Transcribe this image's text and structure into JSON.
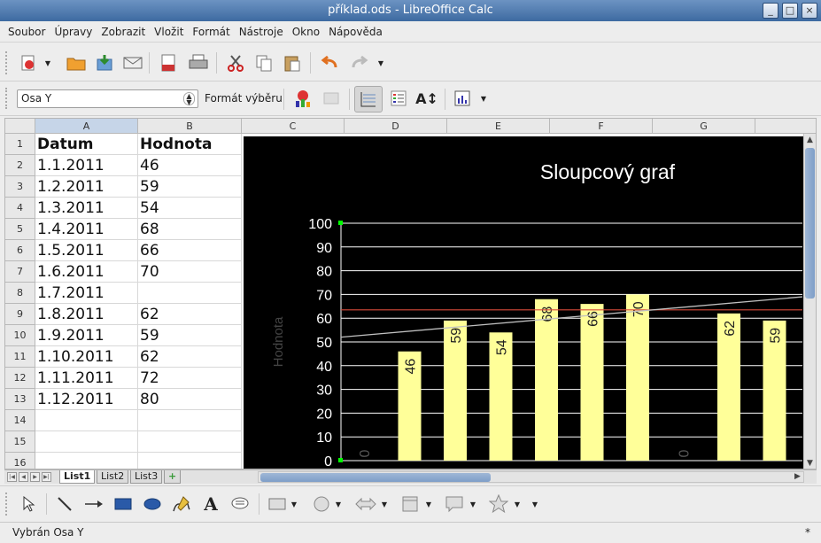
{
  "window": {
    "title": "příklad.ods - LibreOffice Calc"
  },
  "menu": [
    "Soubor",
    "Úpravy",
    "Zobrazit",
    "Vložit",
    "Formát",
    "Nástroje",
    "Okno",
    "Nápověda"
  ],
  "chart_toolbar": {
    "selected_element": "Osa Y",
    "format_selection_label": "Formát výběru"
  },
  "columns": [
    "A",
    "B",
    "C",
    "D",
    "E",
    "F",
    "G"
  ],
  "rows": [
    "1",
    "2",
    "3",
    "4",
    "5",
    "6",
    "7",
    "8",
    "9",
    "10",
    "11",
    "12",
    "13",
    "14",
    "15",
    "16"
  ],
  "cells": [
    [
      "Datum",
      "Hodnota"
    ],
    [
      "1.1.2011",
      "46"
    ],
    [
      "1.2.2011",
      "59"
    ],
    [
      "1.3.2011",
      "54"
    ],
    [
      "1.4.2011",
      "68"
    ],
    [
      "1.5.2011",
      "66"
    ],
    [
      "1.6.2011",
      "70"
    ],
    [
      "1.7.2011",
      ""
    ],
    [
      "1.8.2011",
      "62"
    ],
    [
      "1.9.2011",
      "59"
    ],
    [
      "1.10.2011",
      "62"
    ],
    [
      "1.11.2011",
      "72"
    ],
    [
      "1.12.2011",
      "80"
    ]
  ],
  "sheet_tabs": [
    "List1",
    "List2",
    "List3"
  ],
  "status": {
    "text": "Vybrán Osa Y",
    "right": "*"
  },
  "colors": {
    "bar": "#ffff99",
    "background": "#000000",
    "mean_line": "#d94a3a",
    "trend_line": "#c0c0c0"
  },
  "chart_data": {
    "type": "bar",
    "title": "Sloupcový graf",
    "ylabel": "Hodnota",
    "ylim": [
      0,
      100
    ],
    "yticks": [
      0,
      10,
      20,
      30,
      40,
      50,
      60,
      70,
      80,
      90,
      100
    ],
    "values": [
      0,
      46,
      59,
      54,
      68,
      66,
      70,
      0,
      62,
      59
    ],
    "value_labels": [
      "0",
      "46",
      "59",
      "54",
      "68",
      "66",
      "70",
      "0",
      "62",
      "59"
    ],
    "mean_line": 63.5,
    "trend_line": {
      "start": 52,
      "end": 69
    },
    "grid": true,
    "legend": "none"
  }
}
